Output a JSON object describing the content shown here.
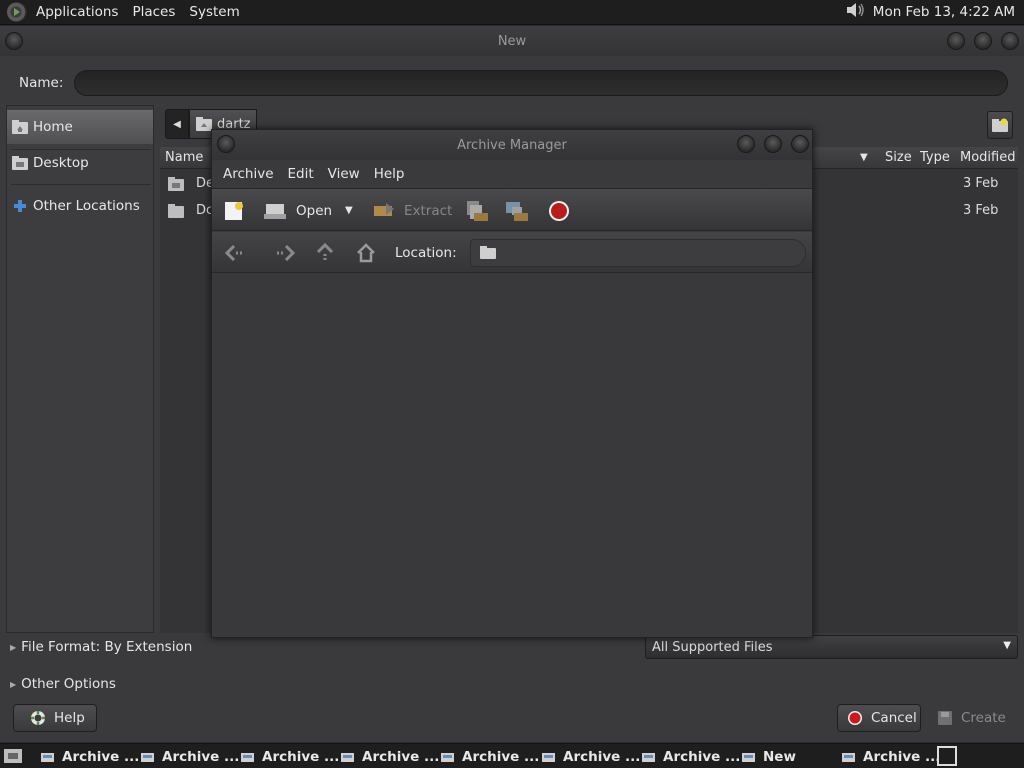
{
  "top_panel": {
    "menus": [
      "Applications",
      "Places",
      "System"
    ],
    "clock": "Mon Feb 13,  4:22 AM",
    "icons": [
      "distro-logo-icon",
      "volume-icon"
    ]
  },
  "dialog": {
    "title": "New",
    "name_label": "Name:",
    "name_value": "",
    "places": [
      {
        "label": "Home",
        "icon": "home-folder-icon",
        "selected": true
      },
      {
        "label": "Desktop",
        "icon": "desktop-folder-icon",
        "selected": false
      },
      {
        "label": "Other Locations",
        "icon": "plus-icon",
        "selected": false
      }
    ],
    "path_current": "dartz",
    "columns": {
      "name": "Name",
      "size": "Size",
      "type": "Type",
      "modified": "Modified"
    },
    "files": [
      {
        "name": "De",
        "modified": "3 Feb",
        "icon": "desktop-folder-icon"
      },
      {
        "name": "Dc",
        "modified": "3 Feb",
        "icon": "folder-icon"
      }
    ],
    "file_format_label": "File Format: By Extension",
    "other_options_label": "Other Options",
    "filter_value": "All Supported Files",
    "help_label": "Help",
    "cancel_label": "Cancel",
    "create_label": "Create"
  },
  "archive_manager": {
    "title": "Archive Manager",
    "menus": [
      "Archive",
      "Edit",
      "View",
      "Help"
    ],
    "toolbar": {
      "open_label": "Open",
      "extract_label": "Extract"
    },
    "location_label": "Location:",
    "location_value": ""
  },
  "taskbar": {
    "tasks": [
      "Archive ...",
      "Archive ...",
      "Archive ...",
      "Archive ...",
      "Archive ...",
      "Archive ...",
      "Archive ...",
      "New",
      "Archive ..."
    ]
  }
}
